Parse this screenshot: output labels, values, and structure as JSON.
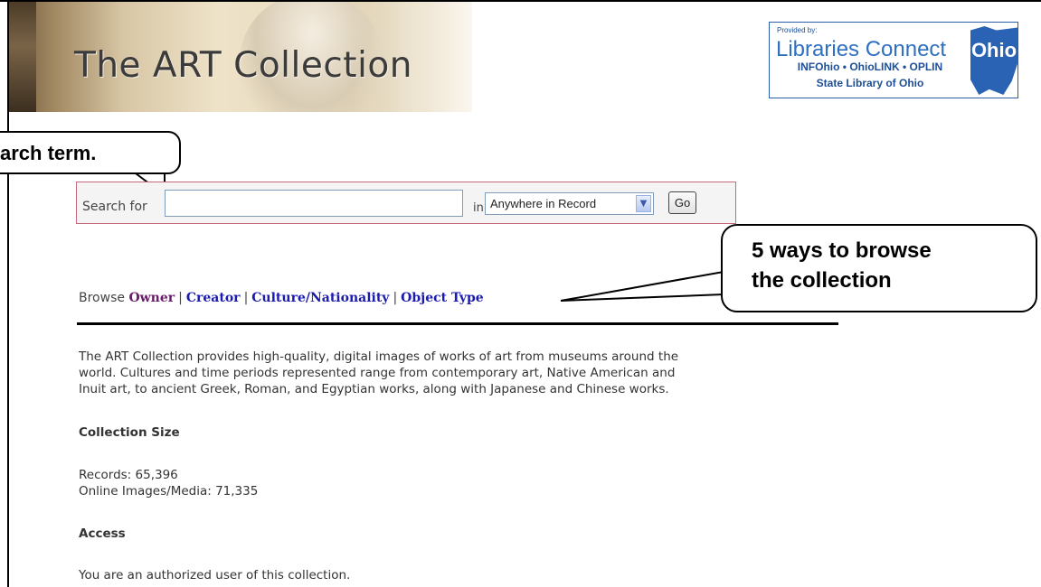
{
  "banner": {
    "title": "The ART Collection"
  },
  "logo": {
    "provided_by": "Provided by:",
    "name": "Libraries Connect",
    "state": "Ohio",
    "line1": "INFOhio • OhioLINK • OPLIN",
    "line2": "State Library of Ohio"
  },
  "callouts": {
    "search": "arch term.",
    "browse_line1": "5 ways to browse",
    "browse_line2": "the collection"
  },
  "search": {
    "label": "Search for",
    "value": "",
    "in_label": "in",
    "scope_selected": "Anywhere in Record",
    "go_label": "Go"
  },
  "browse": {
    "label": "Browse",
    "links": [
      "Owner",
      "Creator",
      "Culture/Nationality",
      "Object Type"
    ],
    "separator": "|"
  },
  "description": [
    "The ART Collection provides high-quality, digital images of works of art from museums around the",
    "world. Cultures and time periods represented range from contemporary art, Native American and",
    "Inuit art, to ancient Greek, Roman, and Egyptian works, along with Japanese and Chinese works."
  ],
  "collection_size": {
    "heading": "Collection Size",
    "records": "Records: 65,396",
    "media": "Online Images/Media: 71,335"
  },
  "access": {
    "heading": "Access",
    "text": "You are an authorized user of this collection."
  }
}
